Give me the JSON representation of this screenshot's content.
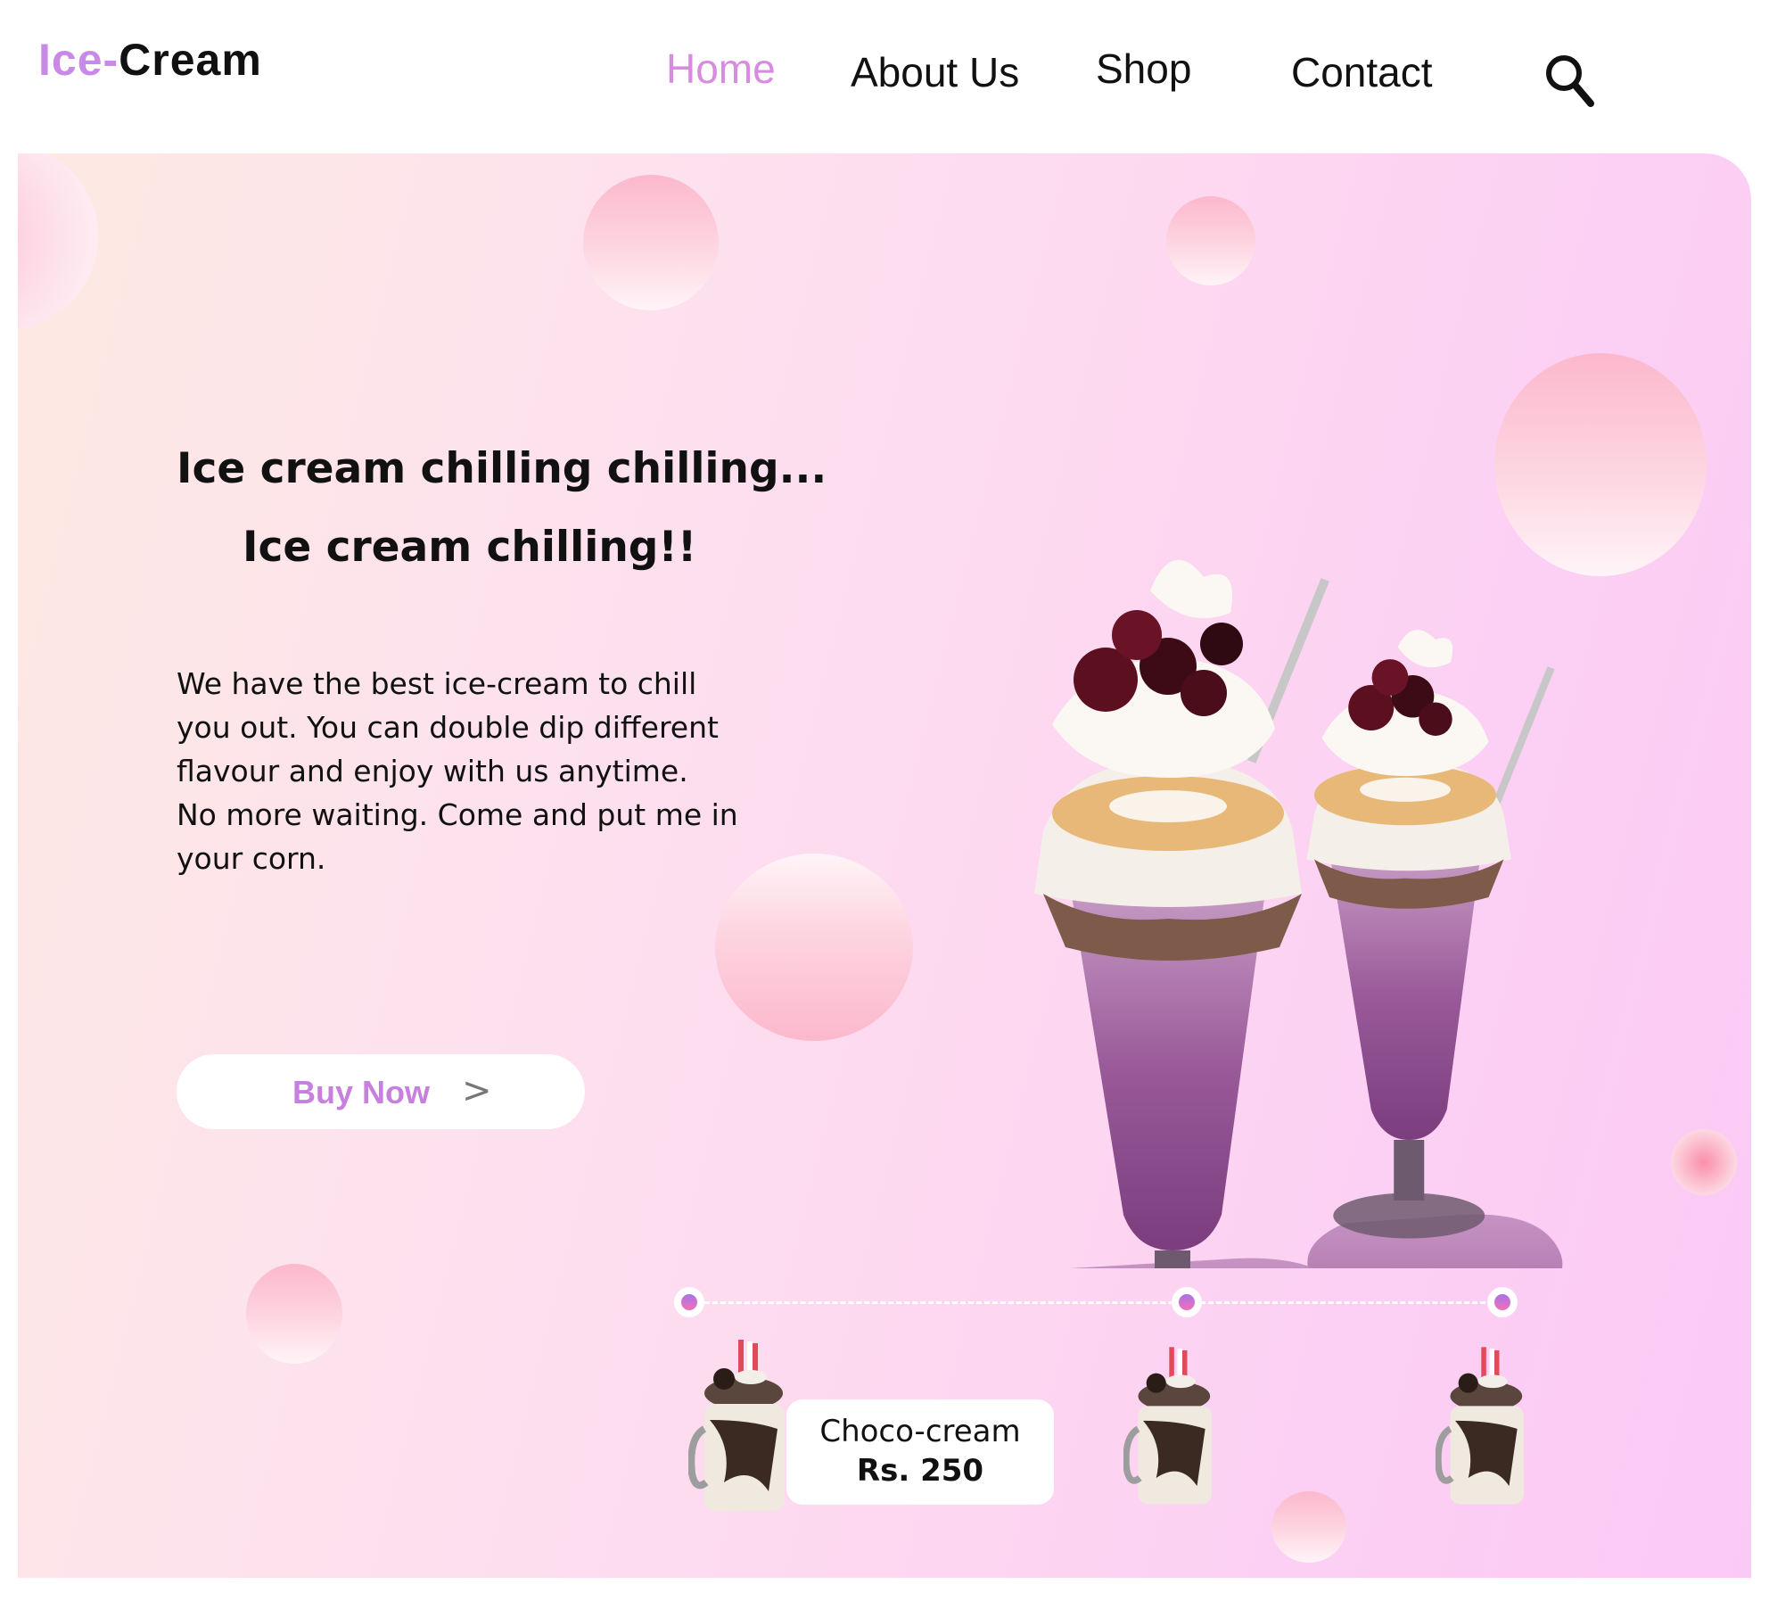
{
  "logo": {
    "part1": "Ice",
    "dash": "-",
    "part2": "Cream"
  },
  "nav": {
    "items": [
      {
        "label": "Home",
        "active": true
      },
      {
        "label": "About Us",
        "active": false
      },
      {
        "label": "Shop",
        "active": false
      },
      {
        "label": "Contact",
        "active": false
      }
    ],
    "search_icon": "search-icon"
  },
  "hero": {
    "headline_1": "Ice cream chilling chilling...",
    "headline_2": "Ice cream chilling!!",
    "description_lines": [
      "We have the best ice-cream to chill",
      "you out. You can double dip different",
      "flavour and enjoy with us anytime.",
      "No more waiting. Come and put me in",
      "your corn."
    ],
    "cta_label": "Buy Now",
    "cta_arrow": ">"
  },
  "product": {
    "name": "Choco-cream",
    "price": "Rs. 250"
  },
  "colors": {
    "accent": "#d78ce0",
    "brand_purple": "#c989e6",
    "background_gradient_start": "#fde9e2",
    "background_gradient_end": "#fbc9f6"
  }
}
